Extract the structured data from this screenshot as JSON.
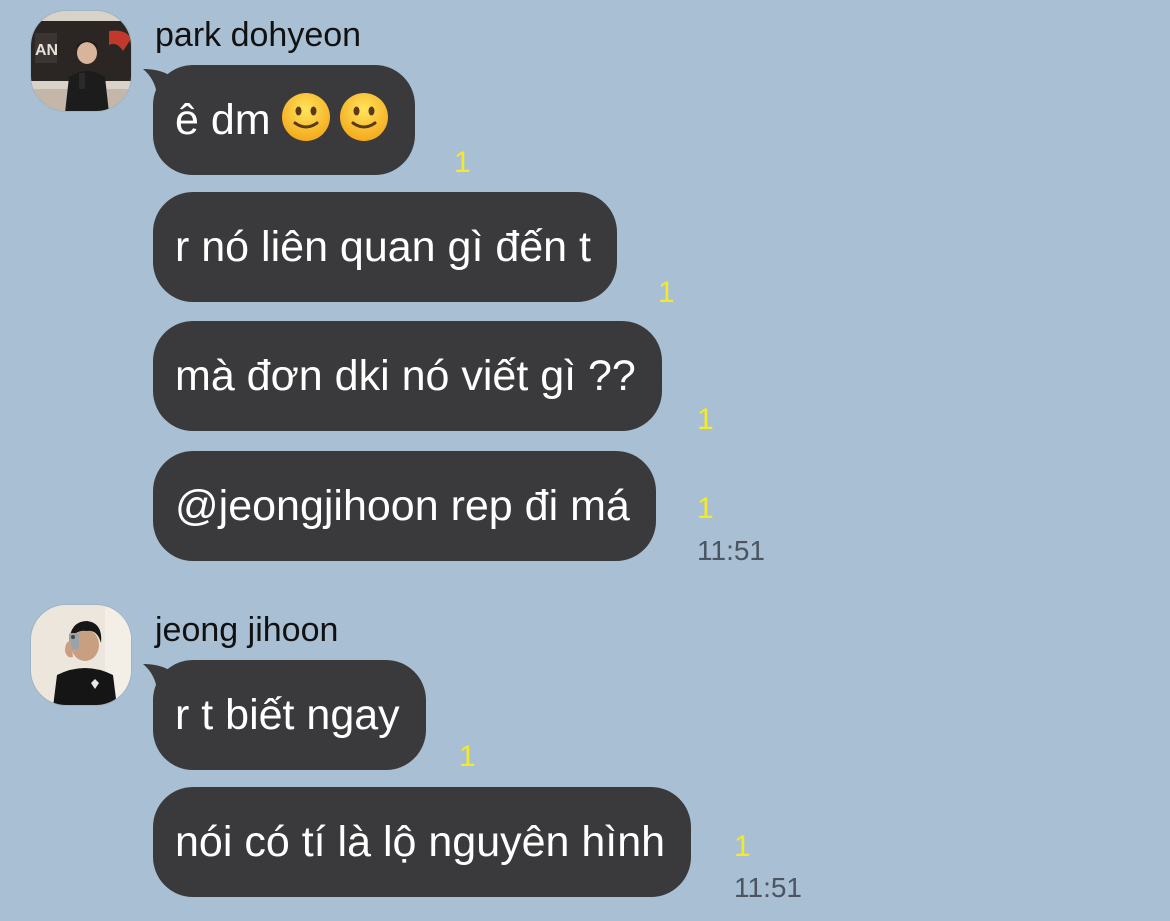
{
  "colors": {
    "background": "#a9bfd3",
    "bubble": "#3a3a3c",
    "bubble_text": "#ffffff",
    "unread_count": "#f5ea2a",
    "timestamp": "#4a5561"
  },
  "groups": [
    {
      "sender": "park dohyeon",
      "avatar_icon": "profile-photo",
      "messages": [
        {
          "text": "ê dm",
          "emojis": [
            "slightly-smiling-face-icon",
            "slightly-smiling-face-icon"
          ],
          "unread": "1"
        },
        {
          "text": "r nó liên quan gì đến t",
          "unread": "1"
        },
        {
          "text": "mà đơn dki nó viết gì ??",
          "unread": "1"
        },
        {
          "text": "@jeongjihoon rep đi má",
          "unread": "1",
          "time": "11:51"
        }
      ]
    },
    {
      "sender": "jeong jihoon",
      "avatar_icon": "profile-photo",
      "messages": [
        {
          "text": "r t biết ngay",
          "unread": "1"
        },
        {
          "text": "nói có tí là lộ nguyên hình",
          "unread": "1",
          "time": "11:51"
        }
      ]
    }
  ]
}
